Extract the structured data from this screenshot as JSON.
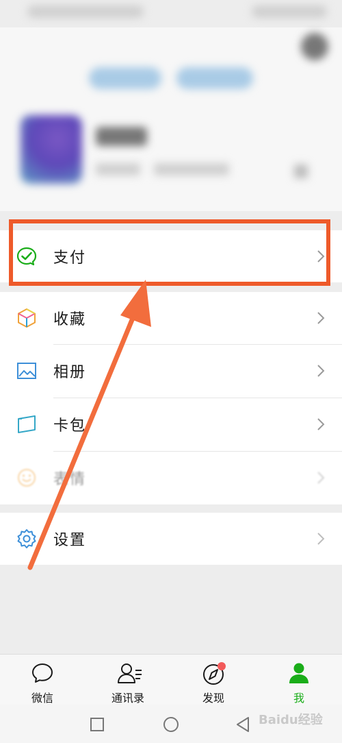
{
  "menu": {
    "pay": "支付",
    "favorites": "收藏",
    "album": "相册",
    "cards": "卡包",
    "stickers": "表情",
    "settings": "设置"
  },
  "tabs": {
    "chats": "微信",
    "contacts": "通讯录",
    "discover": "发现",
    "me": "我"
  },
  "watermark": "Baidu经验",
  "colors": {
    "active_tab": "#1aad19",
    "highlight_box": "#ee5a2a",
    "arrow": "#f26d3d",
    "badge": "#f25a5a"
  }
}
